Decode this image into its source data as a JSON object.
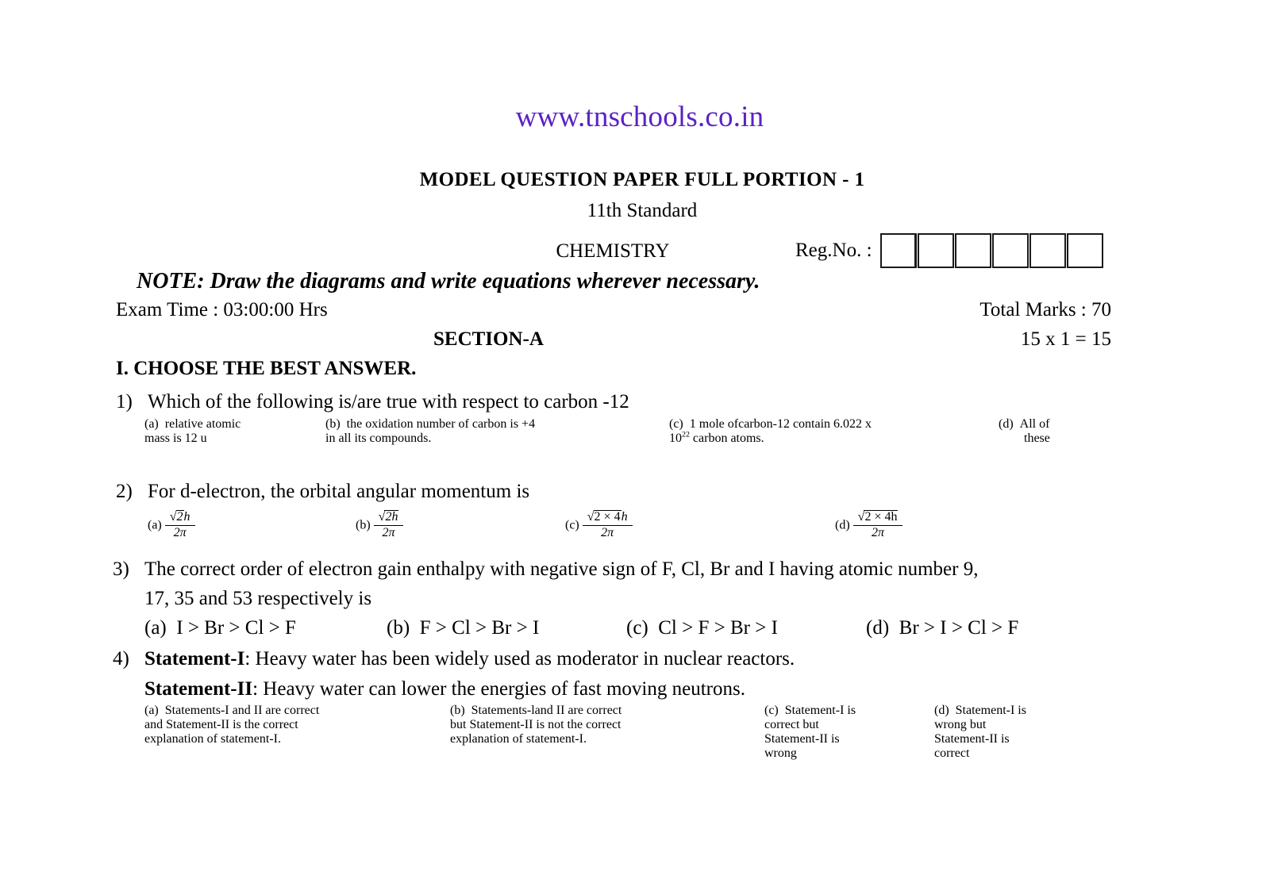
{
  "site": {
    "url": "www.tnschools.co.in",
    "url_color": "#5b22c4"
  },
  "header": {
    "paper_title": "MODEL QUESTION PAPER FULL PORTION - 1",
    "standard": "11th Standard",
    "subject": "CHEMISTRY",
    "regno_label": "Reg.No. :",
    "regno_box_count": 6,
    "note": "NOTE: Draw the diagrams and write equations wherever necessary.",
    "exam_time": "Exam Time : 03:00:00 Hrs",
    "total_marks": "Total Marks : 70",
    "section": "SECTION-A",
    "marks_split": "15 x 1 = 15",
    "instruction": "I. CHOOSE THE BEST ANSWER."
  },
  "questions": [
    {
      "number": "1)",
      "text": "Which of the following is/are true with respect to carbon -12",
      "options": [
        {
          "label": "(a)",
          "line1": "relative atomic",
          "line2": "mass is 12 u"
        },
        {
          "label": "(b)",
          "line1": "the oxidation number of carbon is +4",
          "line2": "in all its compounds."
        },
        {
          "label": "(c)",
          "line1": "1 mole ofcarbon-12 contain 6.022 x",
          "line2_pre": "10",
          "line2_sup": "22",
          "line2_post": " carbon atoms."
        },
        {
          "label": "(d)",
          "line1": "All of",
          "line2": "these"
        }
      ]
    },
    {
      "number": "2)",
      "text": "For d-electron, the orbital angular momentum is",
      "math_options": [
        {
          "label": "(a)",
          "radicand": "2",
          "after_radical": "h",
          "denominator": "2π"
        },
        {
          "label": "(b)",
          "radicand": "2h",
          "after_radical": "",
          "denominator": "2π"
        },
        {
          "label": "(c)",
          "radicand": "2 × 4",
          "after_radical": "h",
          "denominator": "2π"
        },
        {
          "label": "(d)",
          "radicand": "2 × 4h",
          "after_radical": "",
          "denominator": "2π"
        }
      ]
    },
    {
      "number": "3)",
      "text_line1": "The correct order of electron gain enthalpy with negative sign of F, Cl, Br and I having atomic number 9,",
      "text_line2": "17, 35 and 53 respectively is",
      "options": [
        {
          "label": "(a)",
          "line1": "I > Br > Cl > F"
        },
        {
          "label": "(b)",
          "line1": "F > Cl > Br > I"
        },
        {
          "label": "(c)",
          "line1": "Cl > F > Br > I"
        },
        {
          "label": "(d)",
          "line1": "Br > I > Cl > F"
        }
      ]
    },
    {
      "number": "4)",
      "statement_1_label": "Statement-I",
      "statement_1_text": ": Heavy water has been widely used as moderator in nuclear reactors.",
      "statement_2_label": "Statement-II",
      "statement_2_text": ": Heavy water can lower the energies of fast moving neutrons.",
      "options": [
        {
          "label": "(a)",
          "line1": "Statements-I and II are correct",
          "line2": "and Statement-II is the correct",
          "line3": "explanation of statement-I.",
          "line4": ""
        },
        {
          "label": "(b)",
          "line1": "Statements-land II are correct",
          "line2": "but Statement-II is not the correct",
          "line3": "explanation of statement-I.",
          "line4": ""
        },
        {
          "label": "(c)",
          "line1": "Statement-I is",
          "line2": "correct but",
          "line3": "Statement-II is",
          "line4": "wrong"
        },
        {
          "label": "(d)",
          "label_d": "(d)",
          "line1": "Statement-I is",
          "line2": "wrong but",
          "line3": "Statement-II is",
          "line4": "correct"
        }
      ]
    }
  ]
}
